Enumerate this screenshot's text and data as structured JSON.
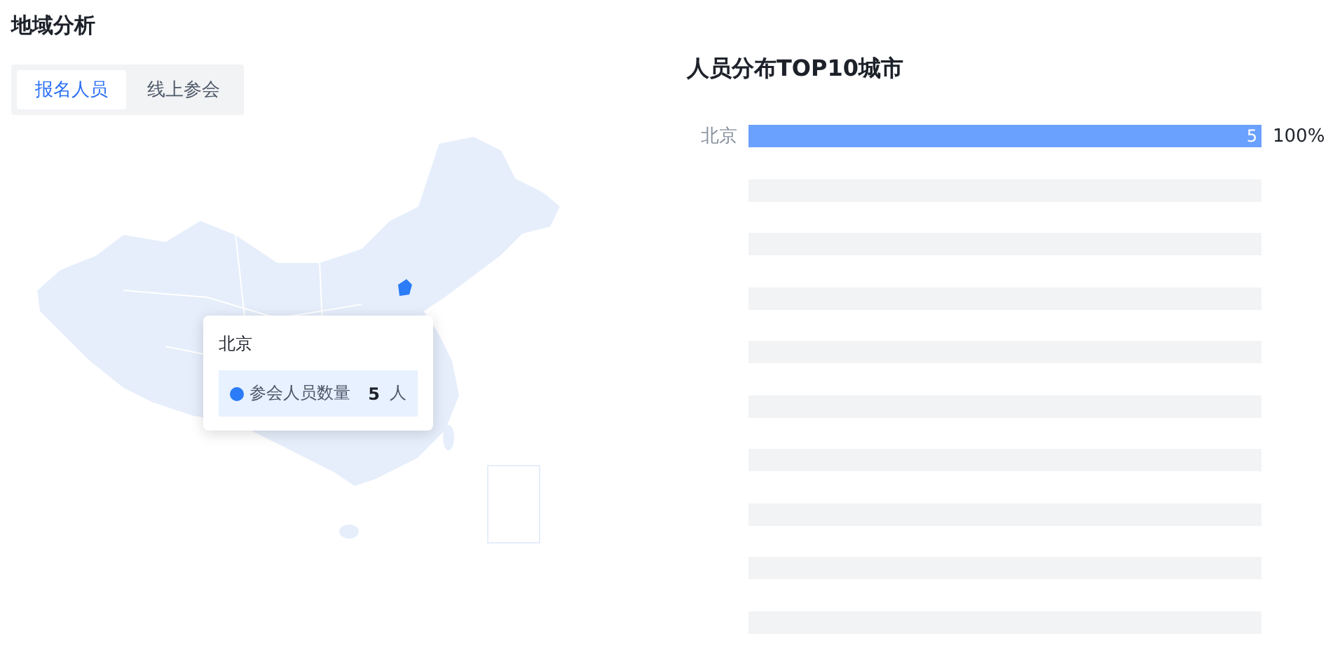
{
  "title": "地域分析",
  "tabs": [
    {
      "label": "报名人员",
      "selected": true
    },
    {
      "label": "线上参会",
      "selected": false
    }
  ],
  "map": {
    "tooltip": {
      "title": "北京",
      "series": "参会人员数量",
      "color": "#2b7cf6",
      "value": "5",
      "unit": "人"
    }
  },
  "ranking": {
    "title": "人员分布TOP10城市",
    "rows": [
      {
        "kind": "filled",
        "city": "北京",
        "value": "5",
        "percent": "100%",
        "level": 1
      },
      {
        "kind": "empty"
      },
      {
        "kind": "empty"
      },
      {
        "kind": "empty"
      },
      {
        "kind": "empty"
      },
      {
        "kind": "empty"
      },
      {
        "kind": "empty"
      },
      {
        "kind": "empty"
      },
      {
        "kind": "empty"
      },
      {
        "kind": "empty"
      }
    ]
  }
}
